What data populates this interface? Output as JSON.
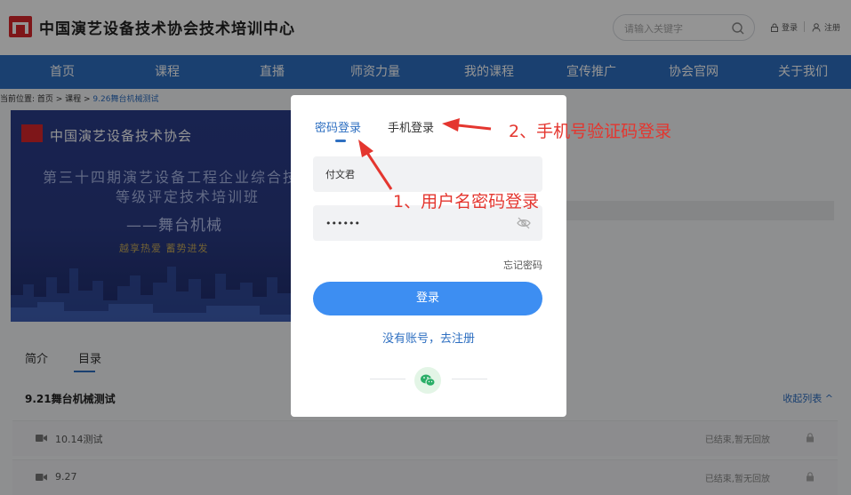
{
  "header": {
    "site_title": "中国演艺设备技术协会技术培训中心",
    "search_placeholder": "请输入关键字",
    "login_label": "登录",
    "register_label": "注册"
  },
  "nav": {
    "items": [
      "首页",
      "课程",
      "直播",
      "师资力量",
      "我的课程",
      "宣传推广",
      "协会官网",
      "关于我们"
    ]
  },
  "breadcrumb": {
    "prefix": "当前位置: 首页 > 课程 > ",
    "current": "9.26舞台机械测试"
  },
  "banner": {
    "org": "中国演艺设备技术协会",
    "line1": "第三十四期演艺设备工程企业综合技",
    "line2": "等级评定技术培训班",
    "line3": "——舞台机械",
    "line4": "越享热爱 蓄势进发"
  },
  "course_tabs": [
    "简介",
    "目录"
  ],
  "chapter": {
    "title": "9.21舞台机械测试",
    "collapse": "收起列表 ^"
  },
  "lessons": [
    {
      "name": "10.14测试",
      "status": "已结束,暂无回放"
    },
    {
      "name": "9.27",
      "status": "已结束,暂无回放"
    }
  ],
  "modal": {
    "tab_password": "密码登录",
    "tab_phone": "手机登录",
    "username_value": "付文君",
    "password_value": "••••••",
    "forgot": "忘记密码",
    "login_button": "登录",
    "register_link": "没有账号，去注册"
  },
  "annotations": {
    "note1": "1、用户名密码登录",
    "note2_prefix": "2、",
    "note2_text": "手机号验证码登录"
  },
  "colors": {
    "brand_blue": "#2e6fc1",
    "button_blue": "#3d8ef2",
    "annotation_red": "#e4362f",
    "logo_red": "#d9262b"
  }
}
